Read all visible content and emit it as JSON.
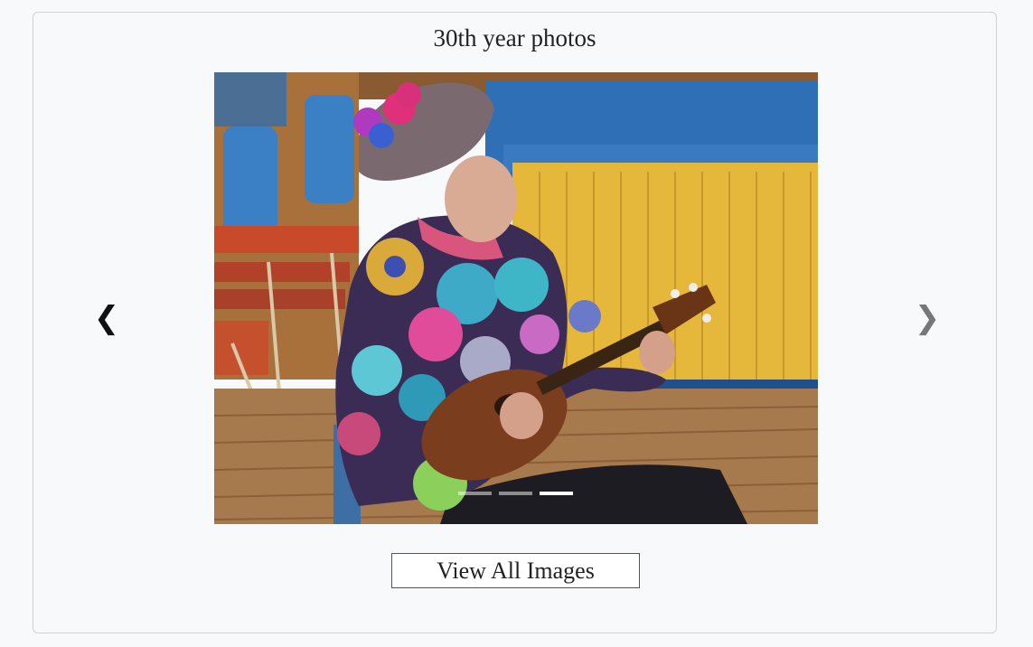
{
  "gallery": {
    "title": "30th year photos",
    "prev_arrow": "❮",
    "next_arrow": "❯",
    "slides_total": 3,
    "active_slide": 3,
    "view_all_label": "View All Images",
    "photo_icon": "photo-image"
  }
}
